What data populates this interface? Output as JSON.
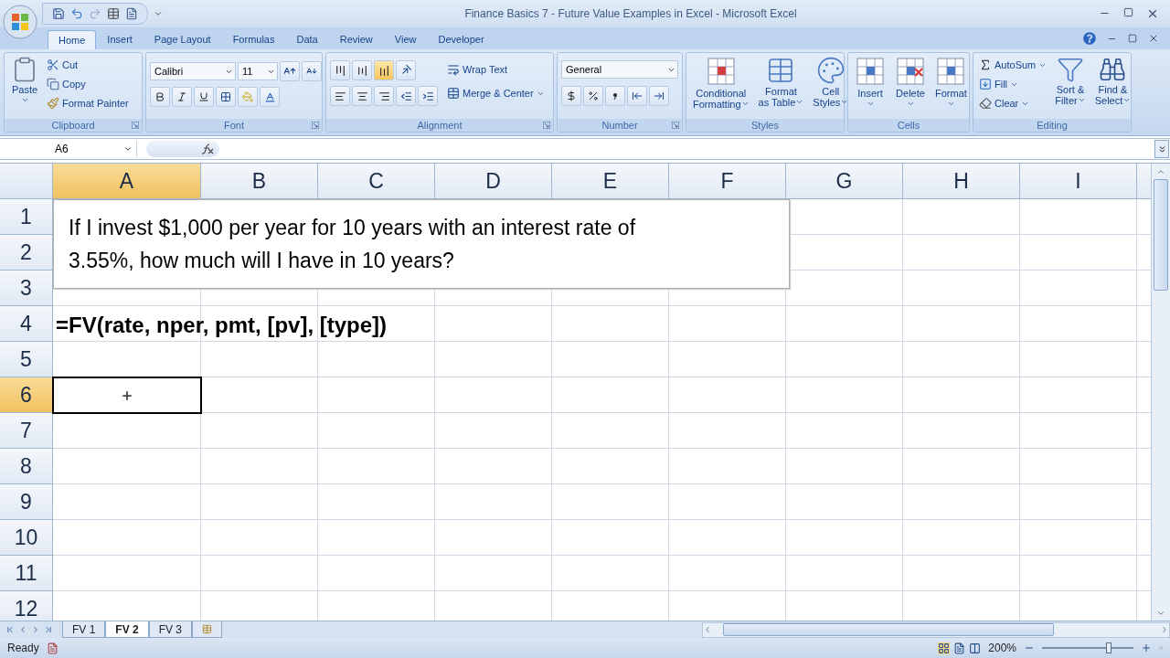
{
  "window": {
    "title": "Finance Basics 7 - Future Value Examples in Excel - Microsoft Excel"
  },
  "tabs": [
    {
      "label": "Home",
      "selected": true
    },
    {
      "label": "Insert",
      "selected": false
    },
    {
      "label": "Page Layout",
      "selected": false
    },
    {
      "label": "Formulas",
      "selected": false
    },
    {
      "label": "Data",
      "selected": false
    },
    {
      "label": "Review",
      "selected": false
    },
    {
      "label": "View",
      "selected": false
    },
    {
      "label": "Developer",
      "selected": false
    }
  ],
  "clipboard": {
    "paste": "Paste",
    "cut": "Cut",
    "copy": "Copy",
    "format_painter": "Format Painter",
    "title": "Clipboard"
  },
  "font": {
    "name": "Calibri",
    "size": "11",
    "title": "Font"
  },
  "alignment": {
    "vertical": [
      {
        "selected": false
      },
      {
        "selected": false
      },
      {
        "selected": true
      }
    ],
    "wrap_text": "Wrap Text",
    "merge": "Merge & Center",
    "title": "Alignment"
  },
  "number": {
    "format": "General",
    "title": "Number"
  },
  "styles": {
    "buttons": [
      "Conditional\nFormatting",
      "Format\nas Table",
      "Cell\nStyles"
    ],
    "title": "Styles"
  },
  "cells": {
    "buttons": [
      "Insert",
      "Delete",
      "Format"
    ],
    "title": "Cells"
  },
  "editing": {
    "autosum": "AutoSum",
    "fill": "Fill",
    "clear": "Clear",
    "sort": "Sort &\nFilter",
    "find": "Find &\nSelect",
    "title": "Editing"
  },
  "formula_bar": {
    "name_box": "A6"
  },
  "sheet": {
    "columns": [
      {
        "label": "A",
        "selected": true
      },
      {
        "label": "B",
        "selected": false
      },
      {
        "label": "C",
        "selected": false
      },
      {
        "label": "D",
        "selected": false
      },
      {
        "label": "E",
        "selected": false
      },
      {
        "label": "F",
        "selected": false
      },
      {
        "label": "G",
        "selected": false
      },
      {
        "label": "H",
        "selected": false
      },
      {
        "label": "I",
        "selected": false
      }
    ],
    "rows": [
      {
        "label": "1",
        "selected": false
      },
      {
        "label": "2",
        "selected": false
      },
      {
        "label": "3",
        "selected": false
      },
      {
        "label": "4",
        "selected": false,
        "cells": [
          "=FV(rate, nper, pmt, [pv], [type])"
        ]
      },
      {
        "label": "5",
        "selected": false
      },
      {
        "label": "6",
        "selected": true
      },
      {
        "label": "7",
        "selected": false
      },
      {
        "label": "8",
        "selected": false
      },
      {
        "label": "9",
        "selected": false
      },
      {
        "label": "10",
        "selected": false
      },
      {
        "label": "11",
        "selected": false
      },
      {
        "label": "12",
        "selected": false
      }
    ],
    "text_box": [
      "If I invest $1,000 per year for 10 years with an interest rate of",
      "3.55%, how much will I have in 10 years?"
    ]
  },
  "sheet_tabs": [
    {
      "label": "FV 1",
      "selected": false
    },
    {
      "label": "FV 2",
      "selected": true
    },
    {
      "label": "FV 3",
      "selected": false
    }
  ],
  "status_bar": {
    "status": "Ready",
    "zoom": "200%",
    "zoom_level": {
      "level": 0.73
    }
  }
}
